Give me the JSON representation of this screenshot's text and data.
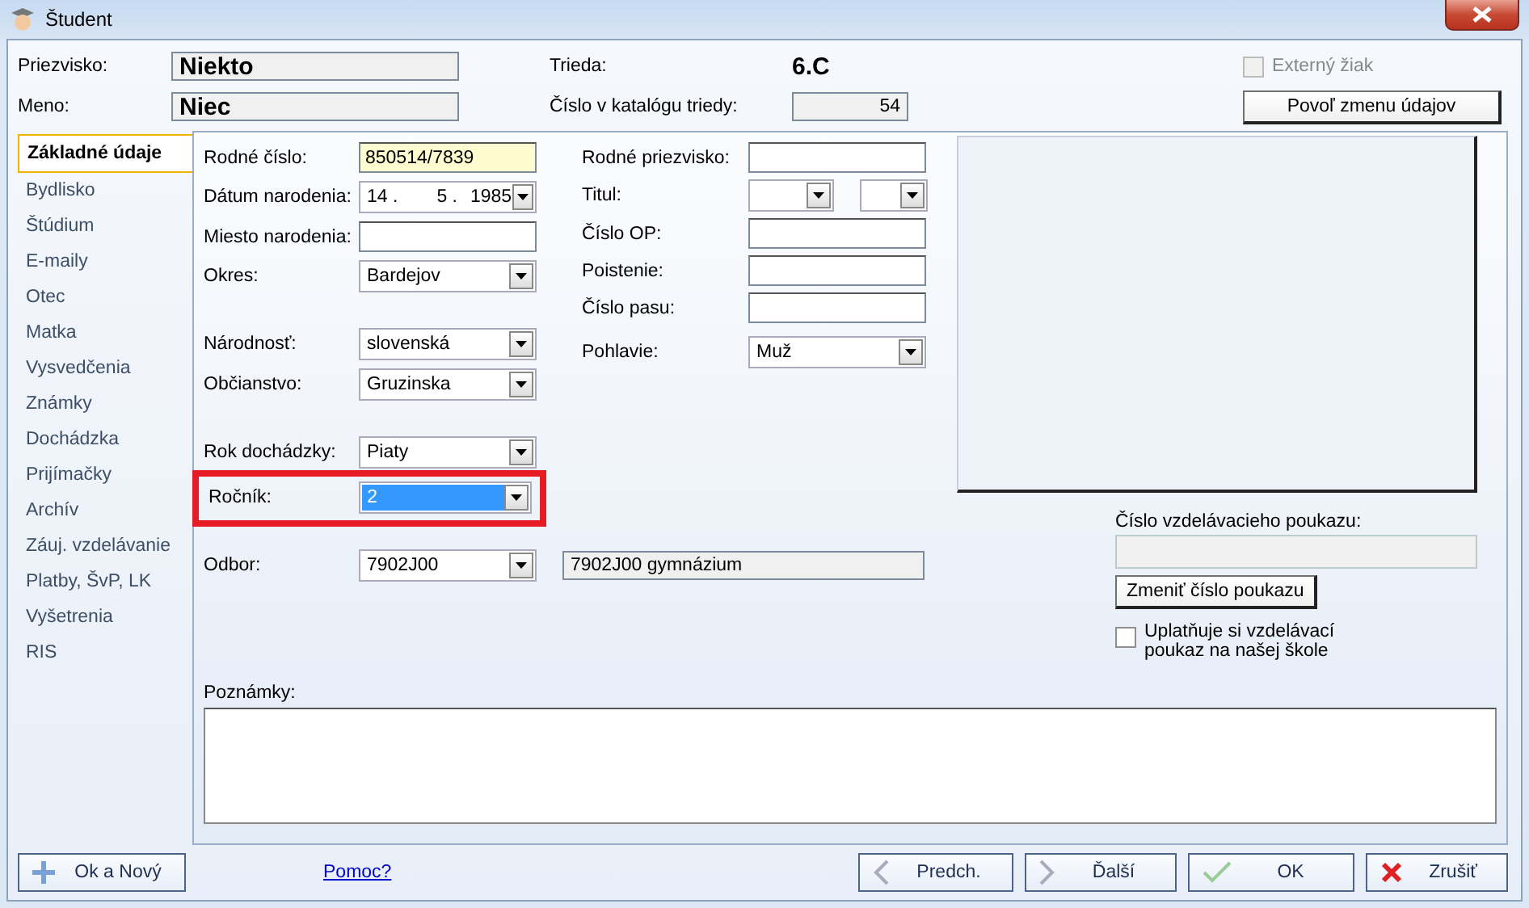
{
  "window": {
    "title": "Študent"
  },
  "header": {
    "surname": {
      "label": "Priezvisko:",
      "value": "Niekto"
    },
    "name": {
      "label": "Meno:",
      "value": "Niec"
    },
    "class": {
      "label": "Trieda:",
      "value": "6.C"
    },
    "catalog": {
      "label": "Číslo v katalógu triedy:",
      "value": "54"
    },
    "external": {
      "label": "Externý žiak",
      "checked": false,
      "disabled": true
    },
    "unlock_button": "Povoľ zmenu údajov"
  },
  "tabs": [
    {
      "label": "Základné údaje",
      "selected": true
    },
    {
      "label": "Bydlisko",
      "selected": false
    },
    {
      "label": "Štúdium",
      "selected": false
    },
    {
      "label": "E-maily",
      "selected": false
    },
    {
      "label": "Otec",
      "selected": false
    },
    {
      "label": "Matka",
      "selected": false
    },
    {
      "label": "Vysvedčenia",
      "selected": false
    },
    {
      "label": "Známky",
      "selected": false
    },
    {
      "label": "Dochádzka",
      "selected": false
    },
    {
      "label": "Prijímačky",
      "selected": false
    },
    {
      "label": "Archív",
      "selected": false
    },
    {
      "label": "Záuj. vzdelávanie",
      "selected": false
    },
    {
      "label": "Platby, ŠvP, LK",
      "selected": false
    },
    {
      "label": "Vyšetrenia",
      "selected": false
    },
    {
      "label": "RIS",
      "selected": false
    }
  ],
  "left_groups": [
    [
      {
        "kind": "input",
        "label": "Rodné číslo:",
        "value": "850514/7839",
        "required": true
      },
      {
        "kind": "date",
        "label": "Dátum narodenia:",
        "day": "14",
        "month": "5",
        "year": "1985",
        "separator": "."
      },
      {
        "kind": "input",
        "label": "Miesto narodenia:",
        "required": false
      },
      {
        "kind": "combo",
        "label": "Okres:",
        "value": "Bardejov"
      }
    ],
    [
      {
        "kind": "combo",
        "label": "Národnosť:",
        "value": "slovenská"
      },
      {
        "kind": "combo",
        "label": "Občianstvo:",
        "value": "Gruzinska"
      }
    ],
    [
      {
        "kind": "combo",
        "label": "Rok dochádzky:",
        "value": "Piaty"
      },
      {
        "kind": "combo",
        "label": "Ročník:",
        "value": "2",
        "focused": true,
        "highlighted": true
      }
    ]
  ],
  "middle_fields": [
    {
      "kind": "input",
      "label": "Rodné priezvisko:"
    },
    {
      "kind": "combo_pair",
      "label": "Titul:"
    },
    {
      "kind": "input",
      "label": "Číslo OP:"
    },
    {
      "kind": "input",
      "label": "Poistenie:"
    },
    {
      "kind": "input",
      "label": "Číslo pasu:"
    },
    {
      "kind": "combo",
      "label": "Pohlavie:",
      "value": "Muž"
    }
  ],
  "odbor": {
    "label": "Odbor:",
    "value": "7902J00",
    "description": "7902J00 gymnázium"
  },
  "voucher": {
    "label": "Číslo vzdelávacieho poukazu:",
    "button": "Zmeniť číslo poukazu",
    "checkbox": {
      "label": "Uplatňuje si vzdelávací poukaz na našej škole",
      "checked": false
    }
  },
  "notes": {
    "label": "Poznámky:"
  },
  "footer": {
    "help_link": "Pomoc?",
    "buttons": [
      {
        "kind": "add",
        "label": "Ok a Nový"
      },
      {
        "kind": "prev",
        "label": "Predch."
      },
      {
        "kind": "next",
        "label": "Ďalší"
      },
      {
        "kind": "ok",
        "label": "OK"
      },
      {
        "kind": "cancel",
        "label": "Zrušiť"
      }
    ]
  }
}
